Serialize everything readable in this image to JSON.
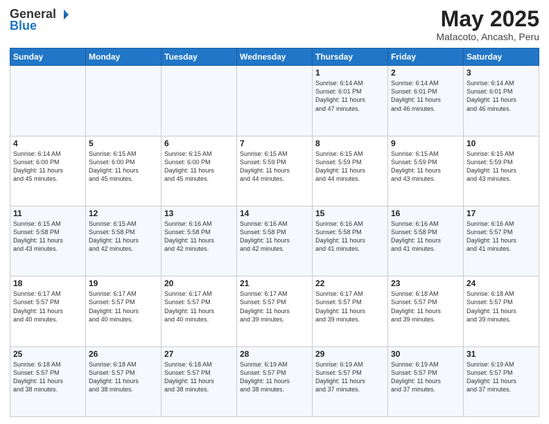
{
  "logo": {
    "general": "General",
    "blue": "Blue"
  },
  "header": {
    "month": "May 2025",
    "location": "Matacoto, Ancash, Peru"
  },
  "weekdays": [
    "Sunday",
    "Monday",
    "Tuesday",
    "Wednesday",
    "Thursday",
    "Friday",
    "Saturday"
  ],
  "weeks": [
    [
      {
        "day": "",
        "info": ""
      },
      {
        "day": "",
        "info": ""
      },
      {
        "day": "",
        "info": ""
      },
      {
        "day": "",
        "info": ""
      },
      {
        "day": "1",
        "info": "Sunrise: 6:14 AM\nSunset: 6:01 PM\nDaylight: 11 hours\nand 47 minutes."
      },
      {
        "day": "2",
        "info": "Sunrise: 6:14 AM\nSunset: 6:01 PM\nDaylight: 11 hours\nand 46 minutes."
      },
      {
        "day": "3",
        "info": "Sunrise: 6:14 AM\nSunset: 6:01 PM\nDaylight: 11 hours\nand 46 minutes."
      }
    ],
    [
      {
        "day": "4",
        "info": "Sunrise: 6:14 AM\nSunset: 6:00 PM\nDaylight: 11 hours\nand 45 minutes."
      },
      {
        "day": "5",
        "info": "Sunrise: 6:15 AM\nSunset: 6:00 PM\nDaylight: 11 hours\nand 45 minutes."
      },
      {
        "day": "6",
        "info": "Sunrise: 6:15 AM\nSunset: 6:00 PM\nDaylight: 11 hours\nand 45 minutes."
      },
      {
        "day": "7",
        "info": "Sunrise: 6:15 AM\nSunset: 5:59 PM\nDaylight: 11 hours\nand 44 minutes."
      },
      {
        "day": "8",
        "info": "Sunrise: 6:15 AM\nSunset: 5:59 PM\nDaylight: 11 hours\nand 44 minutes."
      },
      {
        "day": "9",
        "info": "Sunrise: 6:15 AM\nSunset: 5:59 PM\nDaylight: 11 hours\nand 43 minutes."
      },
      {
        "day": "10",
        "info": "Sunrise: 6:15 AM\nSunset: 5:59 PM\nDaylight: 11 hours\nand 43 minutes."
      }
    ],
    [
      {
        "day": "11",
        "info": "Sunrise: 6:15 AM\nSunset: 5:58 PM\nDaylight: 11 hours\nand 43 minutes."
      },
      {
        "day": "12",
        "info": "Sunrise: 6:15 AM\nSunset: 5:58 PM\nDaylight: 11 hours\nand 42 minutes."
      },
      {
        "day": "13",
        "info": "Sunrise: 6:16 AM\nSunset: 5:58 PM\nDaylight: 11 hours\nand 42 minutes."
      },
      {
        "day": "14",
        "info": "Sunrise: 6:16 AM\nSunset: 5:58 PM\nDaylight: 11 hours\nand 42 minutes."
      },
      {
        "day": "15",
        "info": "Sunrise: 6:16 AM\nSunset: 5:58 PM\nDaylight: 11 hours\nand 41 minutes."
      },
      {
        "day": "16",
        "info": "Sunrise: 6:16 AM\nSunset: 5:58 PM\nDaylight: 11 hours\nand 41 minutes."
      },
      {
        "day": "17",
        "info": "Sunrise: 6:16 AM\nSunset: 5:57 PM\nDaylight: 11 hours\nand 41 minutes."
      }
    ],
    [
      {
        "day": "18",
        "info": "Sunrise: 6:17 AM\nSunset: 5:57 PM\nDaylight: 11 hours\nand 40 minutes."
      },
      {
        "day": "19",
        "info": "Sunrise: 6:17 AM\nSunset: 5:57 PM\nDaylight: 11 hours\nand 40 minutes."
      },
      {
        "day": "20",
        "info": "Sunrise: 6:17 AM\nSunset: 5:57 PM\nDaylight: 11 hours\nand 40 minutes."
      },
      {
        "day": "21",
        "info": "Sunrise: 6:17 AM\nSunset: 5:57 PM\nDaylight: 11 hours\nand 39 minutes."
      },
      {
        "day": "22",
        "info": "Sunrise: 6:17 AM\nSunset: 5:57 PM\nDaylight: 11 hours\nand 39 minutes."
      },
      {
        "day": "23",
        "info": "Sunrise: 6:18 AM\nSunset: 5:57 PM\nDaylight: 11 hours\nand 39 minutes."
      },
      {
        "day": "24",
        "info": "Sunrise: 6:18 AM\nSunset: 5:57 PM\nDaylight: 11 hours\nand 39 minutes."
      }
    ],
    [
      {
        "day": "25",
        "info": "Sunrise: 6:18 AM\nSunset: 5:57 PM\nDaylight: 11 hours\nand 38 minutes."
      },
      {
        "day": "26",
        "info": "Sunrise: 6:18 AM\nSunset: 5:57 PM\nDaylight: 11 hours\nand 38 minutes."
      },
      {
        "day": "27",
        "info": "Sunrise: 6:18 AM\nSunset: 5:57 PM\nDaylight: 11 hours\nand 38 minutes."
      },
      {
        "day": "28",
        "info": "Sunrise: 6:19 AM\nSunset: 5:57 PM\nDaylight: 11 hours\nand 38 minutes."
      },
      {
        "day": "29",
        "info": "Sunrise: 6:19 AM\nSunset: 5:57 PM\nDaylight: 11 hours\nand 37 minutes."
      },
      {
        "day": "30",
        "info": "Sunrise: 6:19 AM\nSunset: 5:57 PM\nDaylight: 11 hours\nand 37 minutes."
      },
      {
        "day": "31",
        "info": "Sunrise: 6:19 AM\nSunset: 5:57 PM\nDaylight: 11 hours\nand 37 minutes."
      }
    ]
  ]
}
